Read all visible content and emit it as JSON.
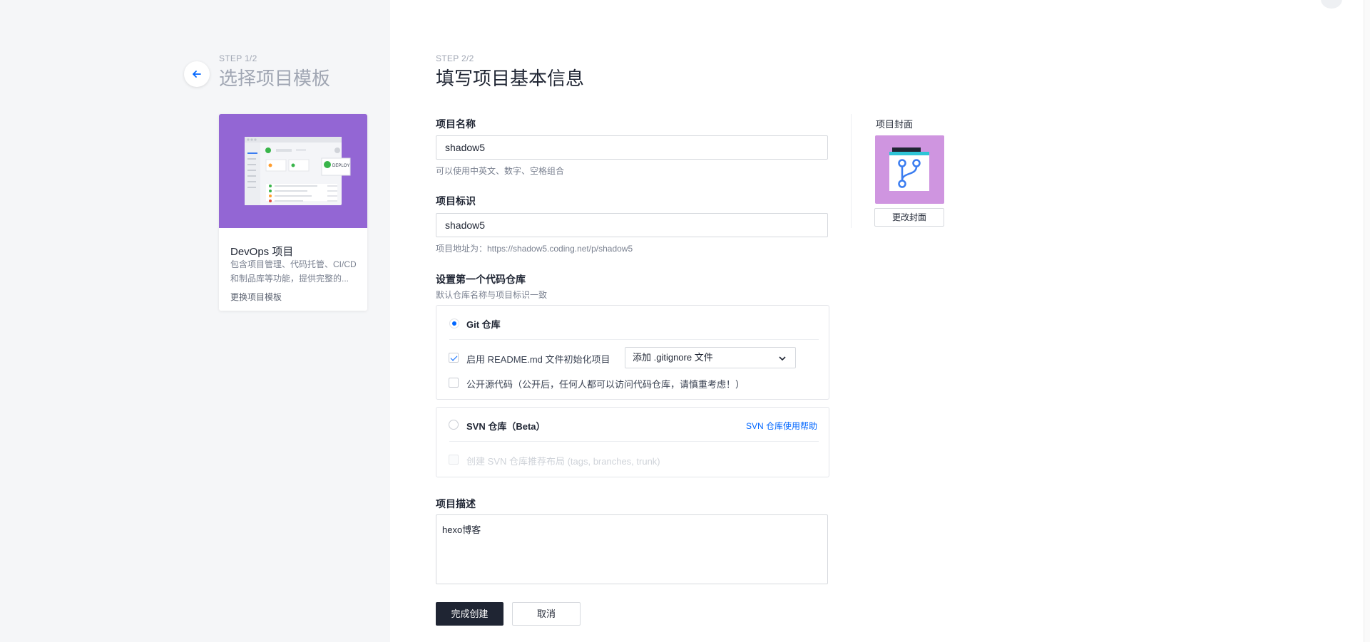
{
  "step1": {
    "step_label": "STEP 1/2",
    "title": "选择项目模板"
  },
  "template": {
    "name": "DevOps 项目",
    "description": "包含项目管理、代码托管、CI/CD 和制品库等功能，提供完整的...",
    "change_link": "更换项目模板",
    "preview_text": "DEPLOY"
  },
  "step2": {
    "step_label": "STEP 2/2",
    "title": "填写项目基本信息"
  },
  "form": {
    "name_label": "项目名称",
    "name_value": "shadow5",
    "name_hint": "可以使用中英文、数字、空格组合",
    "identifier_label": "项目标识",
    "identifier_value": "shadow5",
    "identifier_hint": "项目地址为：https://shadow5.coding.net/p/shadow5",
    "repo_section_label": "设置第一个代码仓库",
    "repo_section_hint": "默认仓库名称与项目标识一致",
    "git": {
      "label": "Git 仓库",
      "readme_label": "启用 README.md 文件初始化项目",
      "gitignore_select": "添加 .gitignore 文件",
      "public_label": "公开源代码（公开后，任何人都可以访问代码仓库，请慎重考虑！）"
    },
    "svn": {
      "label": "SVN 仓库（Beta）",
      "help_link": "SVN 仓库使用帮助",
      "layout_label": "创建 SVN 仓库推荐布局 (tags, branches, trunk)"
    },
    "description_label": "项目描述",
    "description_value": "hexo博客",
    "submit_label": "完成创建",
    "cancel_label": "取消"
  },
  "cover": {
    "label": "项目封面",
    "change_button": "更改封面"
  },
  "colors": {
    "accent": "#0066ff",
    "primary_button": "#1f2533",
    "template_preview_bg": "#9366d4",
    "cover_bg": "#cf95e0",
    "left_pane_bg": "#f5f6f8"
  }
}
